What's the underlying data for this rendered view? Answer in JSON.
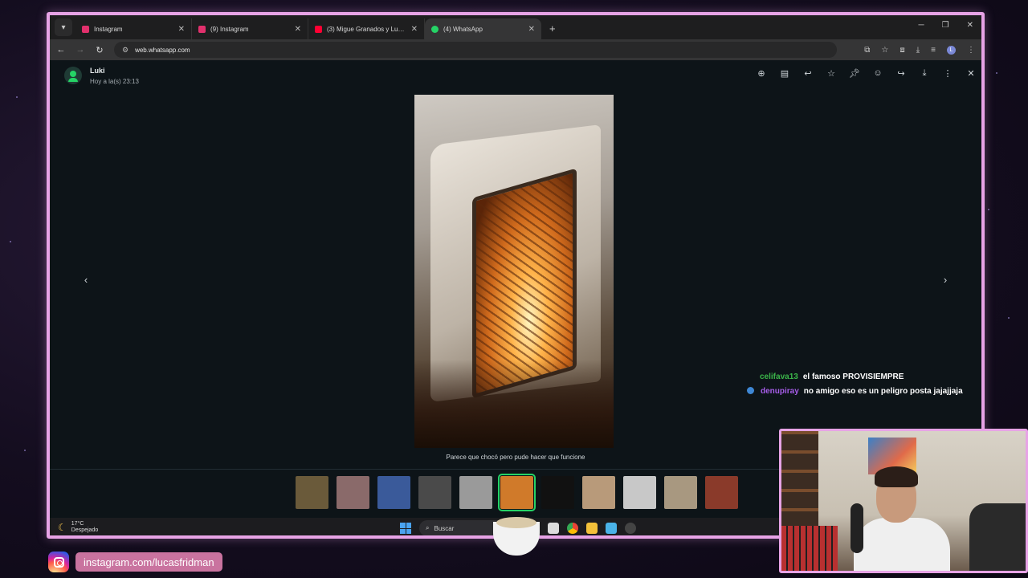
{
  "browser": {
    "tabs": [
      {
        "title": "Instagram",
        "favicon_color": "#e1306c",
        "active": false
      },
      {
        "title": "(9) Instagram",
        "favicon_color": "#e1306c",
        "active": false
      },
      {
        "title": "(3) Migue Granados y Lucas Fri",
        "favicon_color": "#ff0033",
        "active": false
      },
      {
        "title": "(4) WhatsApp",
        "favicon_color": "#25d366",
        "active": true
      }
    ],
    "url": "web.whatsapp.com"
  },
  "viewer": {
    "contact_name": "Luki",
    "timestamp": "Hoy a la(s) 23:13",
    "actions": [
      "zoom-in-icon",
      "caption-icon",
      "reply-icon",
      "star-icon",
      "pin-icon",
      "emoji-icon",
      "forward-icon",
      "download-icon",
      "menu-icon",
      "close-icon"
    ],
    "caption": "Parece que chocó pero pude hacer que funcione",
    "thumbnails": [
      {
        "color": "#6a5a3a",
        "selected": false
      },
      {
        "color": "#8a6a6a",
        "selected": false
      },
      {
        "color": "#3a5a9a",
        "selected": false
      },
      {
        "color": "#4a4a4a",
        "selected": false
      },
      {
        "color": "#9a9a9a",
        "selected": false
      },
      {
        "color": "#d07a2a",
        "selected": true
      },
      {
        "color": "#111111",
        "selected": false
      },
      {
        "color": "#b89a7a",
        "selected": false
      },
      {
        "color": "#c8c8c8",
        "selected": false
      },
      {
        "color": "#a89880",
        "selected": false
      },
      {
        "color": "#8a3a2a",
        "selected": false
      }
    ]
  },
  "chat_overlay": [
    {
      "user": "celifava13",
      "message": "el famoso PROVISIEMPRE"
    },
    {
      "user": "denupiray",
      "message": "no amigo eso es un peligro posta jajajjaja"
    }
  ],
  "taskbar": {
    "temperature": "17°C",
    "weather": "Despejado",
    "search_placeholder": "Buscar"
  },
  "stream": {
    "social_handle": "instagram.com/lucasfridman"
  }
}
